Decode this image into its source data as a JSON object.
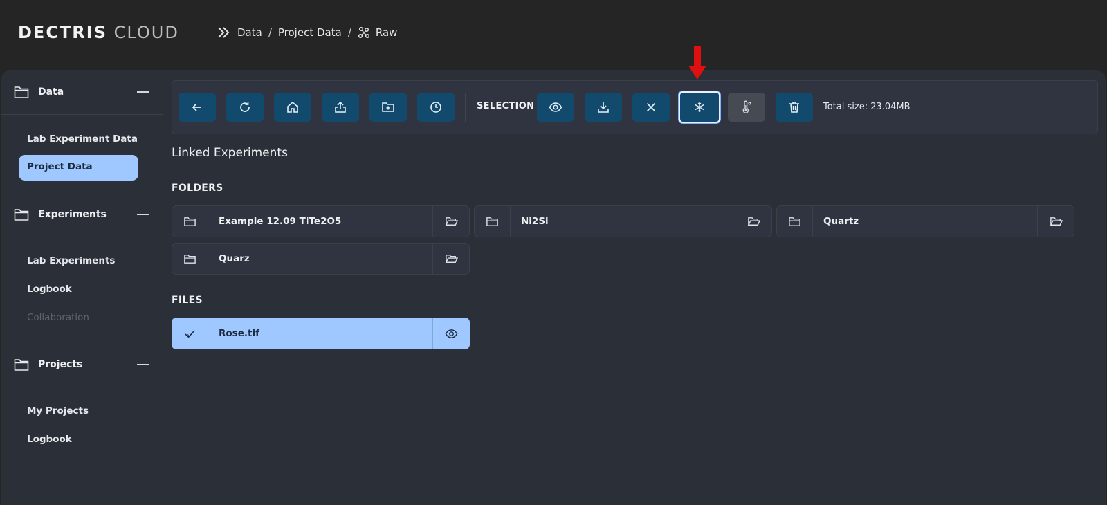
{
  "app": {
    "logo_bold": "DECTRIS",
    "logo_light": "CLOUD"
  },
  "breadcrumb": {
    "items": [
      "Data",
      "Project Data",
      "Raw"
    ]
  },
  "sidebar": {
    "sections": [
      {
        "title": "Data",
        "items": [
          "Lab Experiment Data",
          "Project Data"
        ],
        "active": "Project Data"
      },
      {
        "title": "Experiments",
        "items": [
          "Lab Experiments",
          "Logbook",
          "Collaboration"
        ],
        "disabled": [
          "Collaboration"
        ]
      },
      {
        "title": "Projects",
        "items": [
          "My Projects",
          "Logbook"
        ]
      }
    ]
  },
  "toolbar": {
    "selection_label": "SELECTION",
    "total_size": "Total size: 23.04MB",
    "buttons": [
      "back-icon",
      "refresh-icon",
      "home-icon",
      "upload-icon",
      "new-folder-icon",
      "history-icon",
      "eye-icon",
      "download-icon",
      "close-icon",
      "snowflake-icon",
      "thermometer-icon",
      "trash-icon"
    ],
    "accent_color": "#124a6e",
    "highlight_marker_color": "#e01010"
  },
  "content": {
    "heading": "Linked Experiments",
    "folders_heading": "FOLDERS",
    "files_heading": "FILES",
    "folders": [
      "Example 12.09 TiTe2O5",
      "Ni2Si",
      "Quartz",
      "Quarz"
    ],
    "files": [
      {
        "name": "Rose.tif",
        "selected": true
      }
    ],
    "selected_color": "#9ec8ff"
  }
}
